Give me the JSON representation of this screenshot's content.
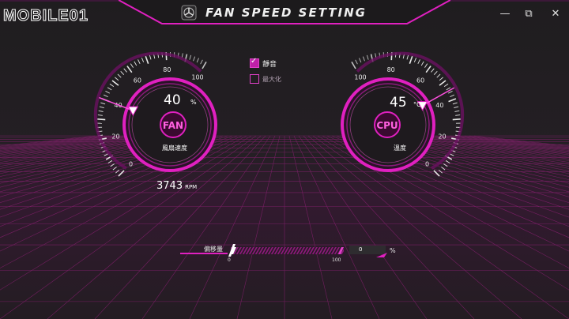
{
  "watermark": {
    "text": "MOBILE01"
  },
  "window": {
    "title": "FAN SPEED SETTING",
    "buttons": {
      "minimize": "—",
      "restore": "⧉",
      "close": "✕"
    }
  },
  "options": [
    {
      "label": "靜音",
      "checked": true
    },
    {
      "label": "最大化",
      "checked": false
    }
  ],
  "fan_gauge": {
    "center_label": "FAN",
    "value": "40",
    "unit": "%",
    "caption": "風扇速度",
    "ticks": [
      "0",
      "20",
      "40",
      "60",
      "80",
      "100"
    ],
    "level": 40,
    "rpm": "3743",
    "rpm_unit": "RPM"
  },
  "cpu_gauge": {
    "center_label": "CPU",
    "value": "45",
    "unit": "°C",
    "caption": "溫度",
    "ticks": [
      "100",
      "80",
      "60",
      "40",
      "20",
      "0"
    ],
    "level": 45
  },
  "offset": {
    "label": "偏移量",
    "min": "0",
    "max": "100",
    "value": "0",
    "unit": "%",
    "level": 0
  },
  "colors": {
    "accent": "#e020c0",
    "accent_light": "#ff60e0",
    "background": "#1f1d1f",
    "grid": "#b0208f"
  }
}
